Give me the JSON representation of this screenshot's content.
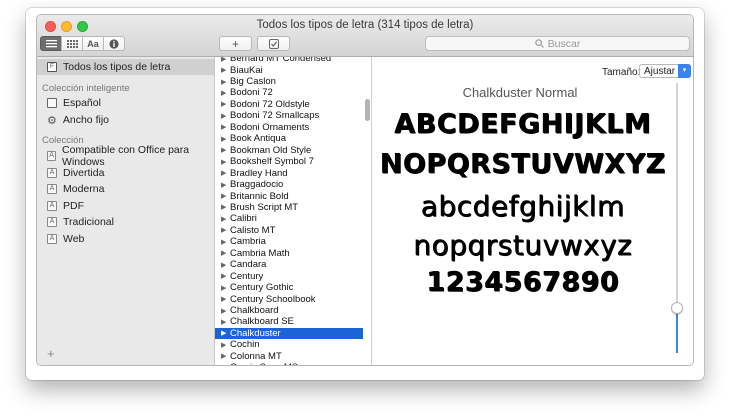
{
  "window": {
    "title": "Todos los tipos de letra (314 tipos de letra)"
  },
  "toolbar": {
    "view_buttons": [
      "≡",
      "⋯",
      "Aa",
      "i"
    ],
    "add_label": "+",
    "check_label": "✓",
    "search_placeholder": "Buscar"
  },
  "sidebar": {
    "all_fonts": "Todos los tipos de letra",
    "smart_section": "Colección inteligente",
    "smart_items": [
      "Español",
      "Ancho fijo"
    ],
    "collection_section": "Colección",
    "collections": [
      "Compatible con Office para Windows",
      "Divertida",
      "Moderna",
      "PDF",
      "Tradicional",
      "Web"
    ],
    "add_label": "+"
  },
  "fontlist": {
    "items": [
      "Bernard MT Condensed",
      "BiauKai",
      "Big Caslon",
      "Bodoni 72",
      "Bodoni 72 Oldstyle",
      "Bodoni 72 Smallcaps",
      "Bodoni Ornaments",
      "Book Antiqua",
      "Bookman Old Style",
      "Bookshelf Symbol 7",
      "Bradley Hand",
      "Braggadocio",
      "Britannic Bold",
      "Brush Script MT",
      "Calibri",
      "Calisto MT",
      "Cambria",
      "Cambria Math",
      "Candara",
      "Century",
      "Century Gothic",
      "Century Schoolbook",
      "Chalkboard",
      "Chalkboard SE",
      "Chalkduster",
      "Cochin",
      "Colonna MT",
      "Comic Sans MS"
    ],
    "selected": "Chalkduster"
  },
  "preview": {
    "size_label": "Tamaño:",
    "size_value": "Ajustar",
    "font_title": "Chalkduster Normal",
    "lines": [
      "ABCDEFGHIJKLM",
      "NOPQRSTUVWXYZ",
      "abcdefghijklm",
      "nopqrstuvwxyz",
      "1234567890"
    ],
    "slider_level": 0.17
  },
  "colors": {
    "accent": "#1a64d8",
    "close": "#fc5f57",
    "minimize": "#fdbc2e",
    "maximize": "#33c748"
  }
}
